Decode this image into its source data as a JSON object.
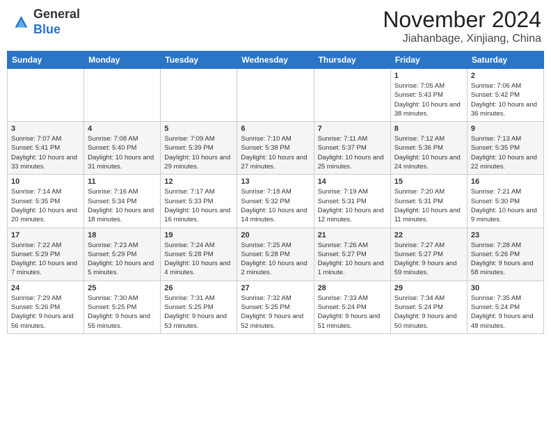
{
  "header": {
    "logo_line1": "General",
    "logo_line2": "Blue",
    "month_year": "November 2024",
    "location": "Jiahanbage, Xinjiang, China"
  },
  "weekdays": [
    "Sunday",
    "Monday",
    "Tuesday",
    "Wednesday",
    "Thursday",
    "Friday",
    "Saturday"
  ],
  "weeks": [
    [
      {
        "day": "",
        "info": ""
      },
      {
        "day": "",
        "info": ""
      },
      {
        "day": "",
        "info": ""
      },
      {
        "day": "",
        "info": ""
      },
      {
        "day": "",
        "info": ""
      },
      {
        "day": "1",
        "info": "Sunrise: 7:05 AM\nSunset: 5:43 PM\nDaylight: 10 hours and 38 minutes."
      },
      {
        "day": "2",
        "info": "Sunrise: 7:06 AM\nSunset: 5:42 PM\nDaylight: 10 hours and 36 minutes."
      }
    ],
    [
      {
        "day": "3",
        "info": "Sunrise: 7:07 AM\nSunset: 5:41 PM\nDaylight: 10 hours and 33 minutes."
      },
      {
        "day": "4",
        "info": "Sunrise: 7:08 AM\nSunset: 5:40 PM\nDaylight: 10 hours and 31 minutes."
      },
      {
        "day": "5",
        "info": "Sunrise: 7:09 AM\nSunset: 5:39 PM\nDaylight: 10 hours and 29 minutes."
      },
      {
        "day": "6",
        "info": "Sunrise: 7:10 AM\nSunset: 5:38 PM\nDaylight: 10 hours and 27 minutes."
      },
      {
        "day": "7",
        "info": "Sunrise: 7:11 AM\nSunset: 5:37 PM\nDaylight: 10 hours and 25 minutes."
      },
      {
        "day": "8",
        "info": "Sunrise: 7:12 AM\nSunset: 5:36 PM\nDaylight: 10 hours and 24 minutes."
      },
      {
        "day": "9",
        "info": "Sunrise: 7:13 AM\nSunset: 5:35 PM\nDaylight: 10 hours and 22 minutes."
      }
    ],
    [
      {
        "day": "10",
        "info": "Sunrise: 7:14 AM\nSunset: 5:35 PM\nDaylight: 10 hours and 20 minutes."
      },
      {
        "day": "11",
        "info": "Sunrise: 7:16 AM\nSunset: 5:34 PM\nDaylight: 10 hours and 18 minutes."
      },
      {
        "day": "12",
        "info": "Sunrise: 7:17 AM\nSunset: 5:33 PM\nDaylight: 10 hours and 16 minutes."
      },
      {
        "day": "13",
        "info": "Sunrise: 7:18 AM\nSunset: 5:32 PM\nDaylight: 10 hours and 14 minutes."
      },
      {
        "day": "14",
        "info": "Sunrise: 7:19 AM\nSunset: 5:31 PM\nDaylight: 10 hours and 12 minutes."
      },
      {
        "day": "15",
        "info": "Sunrise: 7:20 AM\nSunset: 5:31 PM\nDaylight: 10 hours and 11 minutes."
      },
      {
        "day": "16",
        "info": "Sunrise: 7:21 AM\nSunset: 5:30 PM\nDaylight: 10 hours and 9 minutes."
      }
    ],
    [
      {
        "day": "17",
        "info": "Sunrise: 7:22 AM\nSunset: 5:29 PM\nDaylight: 10 hours and 7 minutes."
      },
      {
        "day": "18",
        "info": "Sunrise: 7:23 AM\nSunset: 5:29 PM\nDaylight: 10 hours and 5 minutes."
      },
      {
        "day": "19",
        "info": "Sunrise: 7:24 AM\nSunset: 5:28 PM\nDaylight: 10 hours and 4 minutes."
      },
      {
        "day": "20",
        "info": "Sunrise: 7:25 AM\nSunset: 5:28 PM\nDaylight: 10 hours and 2 minutes."
      },
      {
        "day": "21",
        "info": "Sunrise: 7:26 AM\nSunset: 5:27 PM\nDaylight: 10 hours and 1 minute."
      },
      {
        "day": "22",
        "info": "Sunrise: 7:27 AM\nSunset: 5:27 PM\nDaylight: 9 hours and 59 minutes."
      },
      {
        "day": "23",
        "info": "Sunrise: 7:28 AM\nSunset: 5:26 PM\nDaylight: 9 hours and 58 minutes."
      }
    ],
    [
      {
        "day": "24",
        "info": "Sunrise: 7:29 AM\nSunset: 5:26 PM\nDaylight: 9 hours and 56 minutes."
      },
      {
        "day": "25",
        "info": "Sunrise: 7:30 AM\nSunset: 5:25 PM\nDaylight: 9 hours and 55 minutes."
      },
      {
        "day": "26",
        "info": "Sunrise: 7:31 AM\nSunset: 5:25 PM\nDaylight: 9 hours and 53 minutes."
      },
      {
        "day": "27",
        "info": "Sunrise: 7:32 AM\nSunset: 5:25 PM\nDaylight: 9 hours and 52 minutes."
      },
      {
        "day": "28",
        "info": "Sunrise: 7:33 AM\nSunset: 5:24 PM\nDaylight: 9 hours and 51 minutes."
      },
      {
        "day": "29",
        "info": "Sunrise: 7:34 AM\nSunset: 5:24 PM\nDaylight: 9 hours and 50 minutes."
      },
      {
        "day": "30",
        "info": "Sunrise: 7:35 AM\nSunset: 5:24 PM\nDaylight: 9 hours and 48 minutes."
      }
    ]
  ]
}
